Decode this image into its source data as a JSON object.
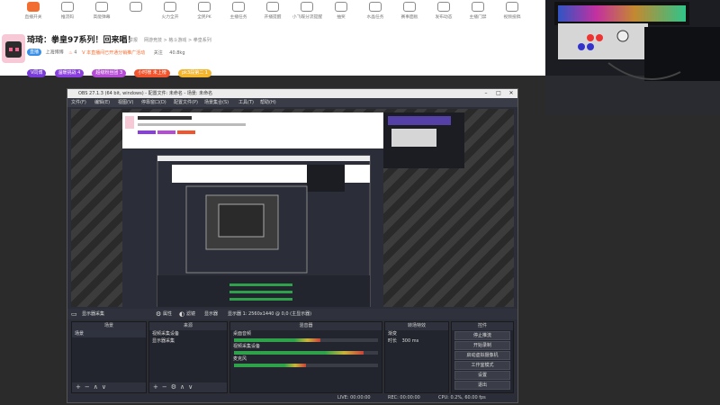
{
  "toolbar": {
    "items": [
      {
        "label": "直播开关",
        "icon": "broadcast-icon"
      },
      {
        "label": "推流码",
        "icon": "signal-icon"
      },
      {
        "label": "高能弹幕",
        "icon": "ai-icon"
      },
      {
        "label": "",
        "icon": "gift-icon"
      },
      {
        "label": "火力全开",
        "icon": "fire-icon"
      },
      {
        "label": "全民PK",
        "icon": "pk-icon"
      },
      {
        "label": "主播任务",
        "icon": "task-icon"
      },
      {
        "label": "开播提醒",
        "icon": "clock-icon"
      },
      {
        "label": "小飞碟分流提醒",
        "icon": "ufo-icon"
      },
      {
        "label": "抽奖",
        "icon": "lottery-icon"
      },
      {
        "label": "水晶任务",
        "icon": "crystal-icon"
      },
      {
        "label": "赛事面板",
        "icon": "panel-icon"
      },
      {
        "label": "发布动态",
        "icon": "post-icon"
      },
      {
        "label": "主播门禁",
        "icon": "gate-icon"
      },
      {
        "label": "视频投稿",
        "icon": "video-icon"
      }
    ]
  },
  "streamer": {
    "title": "琦琦：拳皇97系列！回来唱！",
    "meta1": "举报",
    "meta2": "网游竞技 > 格斗游戏 > 拳皇系列",
    "badge_level": "直播",
    "location": "上海博博",
    "hot": "4",
    "notice": "V 本直播间已开通分销推广活动",
    "follow_label": "关注",
    "fans": "40.8kg",
    "vip_label": "V同博",
    "badges": [
      "温暖挑战 4",
      "超级粉丝团 3",
      "小时榜 未上榜",
      "pk3段第二 1"
    ]
  },
  "obs": {
    "title": "OBS 27.1.3 (64 bit, windows) - 配置文件: 未命名 - 场景: 未命名",
    "menu": [
      "文件(F)",
      "编辑(E)",
      "视图(V)",
      "停靠窗口(D)",
      "配置文件(P)",
      "场景集合(S)",
      "工具(T)",
      "帮助(H)"
    ],
    "source_bar": {
      "current": "显示器采集",
      "props": "属性",
      "filter": "滤镜",
      "display": "显示器",
      "info": "显示器 1: 2560x1440 @ 0,0 (主显示器)"
    },
    "docks": {
      "scenes": {
        "title": "场景",
        "items": [
          "场景"
        ]
      },
      "sources": {
        "title": "来源",
        "items": [
          "视频采集设备",
          "显示器采集"
        ]
      },
      "mixer": {
        "title": "混音器",
        "channels": [
          {
            "name": "桌面音频",
            "db": "0.0 dB",
            "level": 0.6
          },
          {
            "name": "视频采集设备",
            "db": "0.0 dB",
            "level": 0.9
          },
          {
            "name": "麦克风",
            "db": "0.0 dB",
            "level": 0.5
          }
        ]
      },
      "transitions": {
        "title": "转场特效",
        "mode": "渐变",
        "duration_label": "时长",
        "duration": "300 ms"
      },
      "controls": {
        "title": "控件",
        "buttons": [
          "停止推流",
          "开始录制",
          "启动虚拟摄像机",
          "工作室模式",
          "设置",
          "退出"
        ]
      }
    },
    "status": {
      "live": "LIVE: 00:00:00",
      "rec": "REC: 00:00:00",
      "cpu": "CPU: 0.2%, 60.00 fps"
    }
  }
}
